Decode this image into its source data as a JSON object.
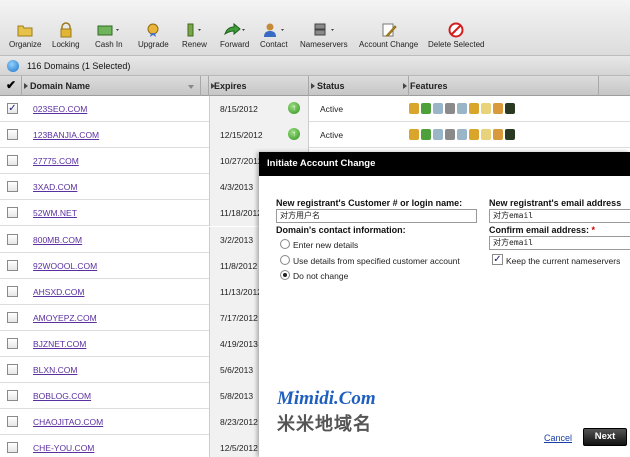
{
  "toolbar": {
    "items": [
      {
        "label": "Organize",
        "icon": "folder-icon"
      },
      {
        "label": "Locking",
        "icon": "lock-icon"
      },
      {
        "label": "Cash In",
        "icon": "cash-in-icon"
      },
      {
        "label": "Upgrade",
        "icon": "upgrade-icon"
      },
      {
        "label": "Renew",
        "icon": "renew-icon"
      },
      {
        "label": "Forward",
        "icon": "forward-icon"
      },
      {
        "label": "Contact",
        "icon": "contact-icon"
      },
      {
        "label": "Nameservers",
        "icon": "nameservers-icon"
      },
      {
        "label": "Account Change",
        "icon": "account-change-icon"
      },
      {
        "label": "Delete Selected",
        "icon": "delete-icon"
      }
    ]
  },
  "summary": {
    "text": "116 Domains (1 Selected)"
  },
  "table": {
    "columns": {
      "domain": "Domain Name",
      "expires": "Expires",
      "status": "Status",
      "features": "Features"
    },
    "rows": [
      {
        "domain": "023SEO.COM",
        "expires": "8/15/2012",
        "status": "Active",
        "checked": true
      },
      {
        "domain": "123BANJIA.COM",
        "expires": "12/15/2012",
        "status": "Active",
        "checked": false
      },
      {
        "domain": "27775.COM",
        "expires": "10/27/2012",
        "status": "",
        "checked": false
      },
      {
        "domain": "3XAD.COM",
        "expires": "4/3/2013",
        "status": "",
        "checked": false
      },
      {
        "domain": "52WM.NET",
        "expires": "11/18/2012",
        "status": "",
        "checked": false
      },
      {
        "domain": "800MB.COM",
        "expires": "3/2/2013",
        "status": "",
        "checked": false
      },
      {
        "domain": "92WOOOL.COM",
        "expires": "11/8/2012",
        "status": "",
        "checked": false
      },
      {
        "domain": "AHSXD.COM",
        "expires": "11/13/2012",
        "status": "",
        "checked": false
      },
      {
        "domain": "AMOYEPZ.COM",
        "expires": "7/17/2012",
        "status": "",
        "checked": false
      },
      {
        "domain": "BJZNET.COM",
        "expires": "4/19/2013",
        "status": "",
        "checked": false
      },
      {
        "domain": "BLXN.COM",
        "expires": "5/6/2013",
        "status": "",
        "checked": false
      },
      {
        "domain": "BOBLOG.COM",
        "expires": "5/8/2013",
        "status": "",
        "checked": false
      },
      {
        "domain": "CHAOJITAO.COM",
        "expires": "8/23/2012",
        "status": "",
        "checked": false
      },
      {
        "domain": "CHE-YOU.COM",
        "expires": "12/5/2012",
        "status": "",
        "checked": false
      }
    ]
  },
  "modal": {
    "title": "Initiate Account Change",
    "registrant_label": "New registrant's Customer # or login name:",
    "registrant_value": "对方用户名",
    "email_label": "New registrant's email address",
    "email_value": "对方email",
    "confirm_label": "Confirm email address:",
    "required_mark": "*",
    "confirm_value": "对方email",
    "contact_label": "Domain's contact information:",
    "options": [
      "Enter new details",
      "Use details from specified customer account",
      "Do not change"
    ],
    "selected_option": 2,
    "keep_ns_label": "Keep the current nameservers",
    "keep_ns_checked": true,
    "watermark_brand": "Mimidi.Com",
    "watermark_cn": "米米地域名",
    "cancel_label": "Cancel",
    "next_label": "Next"
  }
}
